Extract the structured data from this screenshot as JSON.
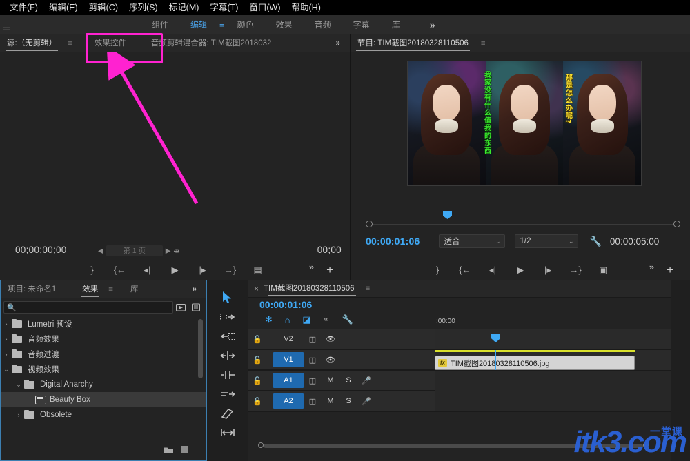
{
  "menubar": {
    "items": [
      "文件(F)",
      "编辑(E)",
      "剪辑(C)",
      "序列(S)",
      "标记(M)",
      "字幕(T)",
      "窗口(W)",
      "帮助(H)"
    ]
  },
  "workspace": {
    "tabs": [
      "组件",
      "编辑",
      "颜色",
      "效果",
      "音频",
      "字幕",
      "库"
    ],
    "active": "编辑",
    "hamburger": "≡",
    "more": "»"
  },
  "source_panel": {
    "tabs": [
      {
        "label": "源:（无剪辑）",
        "active": true,
        "menu": "≡"
      },
      {
        "label": "效果控件",
        "active": false,
        "highlighted": true
      },
      {
        "label": "音频剪辑混合器: TIM截图2018032",
        "active": false
      }
    ],
    "more": "»",
    "timecode_left": "00;00;00;00",
    "timecode_right": "00;00",
    "page_label": "第 1 页",
    "prev_arrow": "◀",
    "next_arrow": "▶",
    "transport": [
      "mark-out",
      "go-to-in",
      "step-back",
      "play",
      "step-forward",
      "go-to-out",
      "insert"
    ],
    "more_button": "»",
    "add_button": "+"
  },
  "program_panel": {
    "title": "节目: TIM截图20180328110506",
    "menu": "≡",
    "timecode_current": "00:00:01:06",
    "fit_label": "适合",
    "resolution_label": "1/2",
    "wrench_icon": "wrench-icon",
    "timecode_duration": "00:00:05:00",
    "dropdown_caret": "⌄",
    "video": {
      "overlay_texts": [
        {
          "text": "我家没有什么值我的东西",
          "color": "#39e82c"
        },
        {
          "text": "那是怎么办呢?",
          "color": "#ffe32e"
        }
      ]
    },
    "transport": [
      "mark-out",
      "go-to-in",
      "step-back",
      "play",
      "step-forward",
      "go-to-out",
      "export-frame"
    ],
    "more_button": "»",
    "add_button": "+"
  },
  "effects_panel": {
    "tabs": [
      {
        "label": "项目: 未命名1",
        "active": false
      },
      {
        "label": "效果",
        "active": true,
        "menu": "≡"
      },
      {
        "label": "库",
        "active": false
      }
    ],
    "more": "»",
    "search_placeholder": "",
    "search_value": "",
    "search_icon": "search-icon",
    "header_icons": [
      "new-preset-icon",
      "new-bin-icon"
    ],
    "tree": [
      {
        "label": "Lumetri 预设",
        "depth": 0,
        "twisty": "›",
        "icon": "preset-folder-icon",
        "selected": false
      },
      {
        "label": "音频效果",
        "depth": 0,
        "twisty": "›",
        "icon": "folder-icon",
        "selected": false
      },
      {
        "label": "音频过渡",
        "depth": 0,
        "twisty": "›",
        "icon": "folder-icon",
        "selected": false
      },
      {
        "label": "视频效果",
        "depth": 0,
        "twisty": "⌄",
        "icon": "folder-icon",
        "selected": false
      },
      {
        "label": "Digital Anarchy",
        "depth": 1,
        "twisty": "⌄",
        "icon": "folder-icon",
        "selected": false
      },
      {
        "label": "Beauty Box",
        "depth": 2,
        "twisty": "",
        "icon": "effect-icon",
        "selected": true
      },
      {
        "label": "Obsolete",
        "depth": 1,
        "twisty": "›",
        "icon": "folder-icon",
        "selected": false
      }
    ],
    "footer_icons": [
      "new-bin-icon",
      "delete-icon"
    ]
  },
  "tools": [
    {
      "name": "selection-tool",
      "glyph": "➤",
      "active": true
    },
    {
      "name": "track-select-forward-tool",
      "glyph": "⇥",
      "active": false
    },
    {
      "name": "track-select-backward-tool",
      "glyph": "⇤",
      "active": false
    },
    {
      "name": "ripple-edit-tool",
      "glyph": "↔",
      "active": false
    },
    {
      "name": "rolling-edit-tool",
      "glyph": "⇹",
      "active": false
    },
    {
      "name": "rate-stretch-tool",
      "glyph": "⇢",
      "active": false
    },
    {
      "name": "razor-tool",
      "glyph": "◆",
      "active": false
    },
    {
      "name": "slip-tool",
      "glyph": "|↔|",
      "active": false
    }
  ],
  "timeline_panel": {
    "close": "×",
    "title": "TIM截图20180328110506",
    "menu": "≡",
    "timecode": "00:00:01:06",
    "toolbar_icons": [
      {
        "name": "snap-insert-icon",
        "active": true
      },
      {
        "name": "magnet-snap-icon",
        "active": true
      },
      {
        "name": "linked-selection-icon",
        "active": true
      },
      {
        "name": "marker-icon",
        "active": false
      },
      {
        "name": "timeline-settings-icon",
        "active": false
      }
    ],
    "ruler_label": ":00:00",
    "tracks": [
      {
        "name": "V2",
        "type": "video",
        "selected": false,
        "lock": "🔓",
        "sync": "sync-icon",
        "eye": "eye-icon"
      },
      {
        "name": "V1",
        "type": "video",
        "selected": true,
        "lock": "🔓",
        "sync": "sync-icon",
        "eye": "eye-icon"
      },
      {
        "name": "A1",
        "type": "audio",
        "selected": true,
        "lock": "🔓",
        "sync": "sync-icon",
        "mute": "M",
        "solo": "S",
        "mic": "mic-icon"
      },
      {
        "name": "A2",
        "type": "audio",
        "selected": true,
        "lock": "🔓",
        "sync": "sync-icon",
        "mute": "M",
        "solo": "S",
        "mic": "mic-icon"
      }
    ],
    "clip": {
      "label": "TIM截图20180328110506.jpg",
      "fx_badge": "fx"
    }
  },
  "annotation": {
    "highlight_color": "#ff22d0",
    "highlight_target": "效果控件"
  },
  "watermark": {
    "main": "itk3.com",
    "sub": "一堂课"
  }
}
